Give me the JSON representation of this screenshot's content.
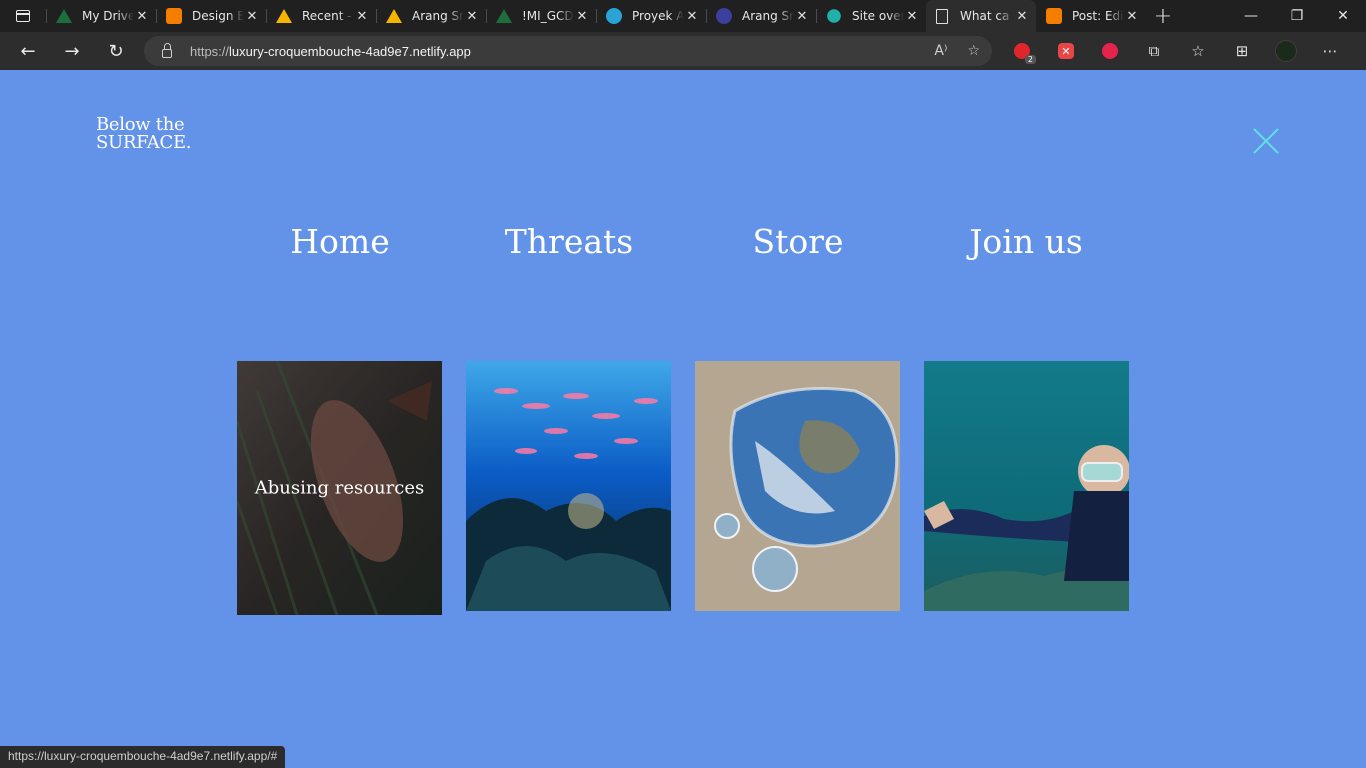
{
  "browser": {
    "tabs": [
      {
        "title": "My Drive",
        "icon": "drive-icon",
        "color": "#1c6e3a"
      },
      {
        "title": "Design E",
        "icon": "blogger-icon",
        "color": "#f57d00"
      },
      {
        "title": "Recent -",
        "icon": "drive-icon",
        "color": "#f4b400"
      },
      {
        "title": "Arang Sr",
        "icon": "drive-icon",
        "color": "#f4b400"
      },
      {
        "title": "!MI_GCD",
        "icon": "drive-icon",
        "color": "#1c6e3a"
      },
      {
        "title": "Proyek A",
        "icon": "canva-icon",
        "color": "#2aa3d6"
      },
      {
        "title": "Arang Sr",
        "icon": "canva-icon",
        "color": "#3c3f9c"
      },
      {
        "title": "Site over",
        "icon": "netlify-icon",
        "color": "#20b2aa"
      },
      {
        "title": "What ca",
        "icon": "page-icon",
        "color": "#2d2d2d"
      },
      {
        "title": "Post: Edi",
        "icon": "blogger-icon",
        "color": "#f57d00"
      }
    ],
    "url_prefix": "https://",
    "url_host": "luxury-croquembouche-4ad9e7.netlify.app",
    "extension_badge": "2",
    "status_url": "https://luxury-croquembouche-4ad9e7.netlify.app/#"
  },
  "site": {
    "logo_line1": "Below the",
    "logo_line2": "SURFACE.",
    "nav": [
      "Home",
      "Threats",
      "Store",
      "Join us"
    ],
    "cards": [
      {
        "caption": "Abusing resources",
        "image": "fish-in-net",
        "colors": [
          "#3b3a3a",
          "#5b4a42",
          "#2a3a2a"
        ]
      },
      {
        "caption": "",
        "image": "coral-reef-fish",
        "colors": [
          "#0a67c7",
          "#0d3d8f",
          "#0a2a4a"
        ]
      },
      {
        "caption": "",
        "image": "earth-water-drop",
        "colors": [
          "#b9a993",
          "#3c78b8",
          "#d9d1c4"
        ]
      },
      {
        "caption": "",
        "image": "scuba-diver",
        "colors": [
          "#0f8a8e",
          "#0a5e6a",
          "#1b3e4a"
        ]
      }
    ],
    "accent": "#5fe3e1",
    "background": "#6392e9"
  }
}
